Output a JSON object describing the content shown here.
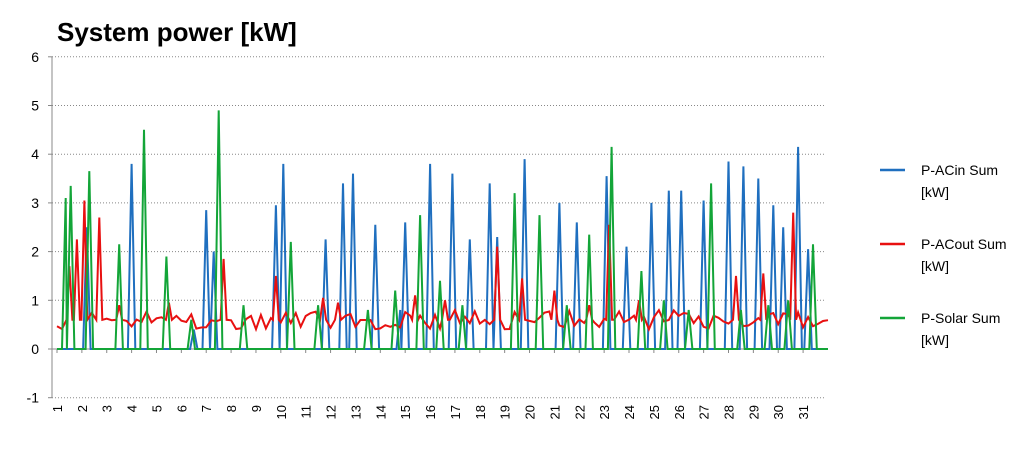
{
  "chart_data": {
    "type": "line",
    "title": "System power [kW]",
    "xlabel": "",
    "ylabel": "",
    "ylim": [
      -1,
      6
    ],
    "yticks": [
      "-1",
      "0",
      "1",
      "2",
      "3",
      "4",
      "5",
      "6"
    ],
    "xticks": [
      "1",
      "2",
      "3",
      "4",
      "5",
      "6",
      "7",
      "8",
      "9",
      "10",
      "11",
      "12",
      "13",
      "14",
      "15",
      "16",
      "17",
      "18",
      "19",
      "20",
      "21",
      "22",
      "23",
      "24",
      "25",
      "26",
      "27",
      "28",
      "29",
      "30",
      "31"
    ],
    "grid": true,
    "legend": "right",
    "series": [
      {
        "name": "P-ACin Sum [kW]",
        "legend_lines": [
          "P-ACin Sum",
          "[kW]"
        ],
        "color": "#1f6fbf",
        "baseline": 0,
        "peaks": [
          [
            2.2,
            2.5
          ],
          [
            4.0,
            3.8
          ],
          [
            6.5,
            0.4
          ],
          [
            7.0,
            2.85
          ],
          [
            7.3,
            2.0
          ],
          [
            9.8,
            2.95
          ],
          [
            10.1,
            3.8
          ],
          [
            11.8,
            2.25
          ],
          [
            12.5,
            3.4
          ],
          [
            12.9,
            3.6
          ],
          [
            13.8,
            2.55
          ],
          [
            14.8,
            0.8
          ],
          [
            15.0,
            2.6
          ],
          [
            16.0,
            3.8
          ],
          [
            16.9,
            3.6
          ],
          [
            17.6,
            2.25
          ],
          [
            18.4,
            3.4
          ],
          [
            18.7,
            2.3
          ],
          [
            19.8,
            3.9
          ],
          [
            21.2,
            3.0
          ],
          [
            21.9,
            2.6
          ],
          [
            23.1,
            3.55
          ],
          [
            23.9,
            2.1
          ],
          [
            24.9,
            3.0
          ],
          [
            25.6,
            3.25
          ],
          [
            26.1,
            3.25
          ],
          [
            27.0,
            3.05
          ],
          [
            28.0,
            3.85
          ],
          [
            28.6,
            3.75
          ],
          [
            29.2,
            3.5
          ],
          [
            29.8,
            2.95
          ],
          [
            30.2,
            2.5
          ],
          [
            30.8,
            4.15
          ],
          [
            31.2,
            2.05
          ]
        ]
      },
      {
        "name": "P-ACout Sum [kW]",
        "legend_lines": [
          "P-ACout Sum",
          "[kW]"
        ],
        "color": "#e81010",
        "baseline": 0.6,
        "peaks": [
          [
            1.5,
            1.7
          ],
          [
            1.8,
            2.25
          ],
          [
            2.1,
            3.05
          ],
          [
            2.7,
            2.7
          ],
          [
            3.5,
            0.9
          ],
          [
            5.5,
            0.95
          ],
          [
            7.7,
            1.85
          ],
          [
            9.8,
            1.5
          ],
          [
            11.7,
            1.05
          ],
          [
            12.3,
            0.95
          ],
          [
            15.4,
            1.1
          ],
          [
            16.6,
            1.0
          ],
          [
            18.7,
            2.1
          ],
          [
            19.7,
            1.45
          ],
          [
            21.0,
            1.2
          ],
          [
            22.4,
            0.9
          ],
          [
            23.2,
            2.55
          ],
          [
            24.4,
            1.0
          ],
          [
            28.3,
            1.5
          ],
          [
            29.4,
            1.55
          ],
          [
            30.6,
            2.8
          ]
        ]
      },
      {
        "name": "P-Solar Sum [kW]",
        "legend_lines": [
          "P-Solar Sum",
          "[kW]"
        ],
        "color": "#13a538",
        "baseline": 0,
        "peaks": [
          [
            1.35,
            3.1
          ],
          [
            1.55,
            3.35
          ],
          [
            2.3,
            3.65
          ],
          [
            3.5,
            2.15
          ],
          [
            4.5,
            4.5
          ],
          [
            5.4,
            1.9
          ],
          [
            6.4,
            0.6
          ],
          [
            7.5,
            4.9
          ],
          [
            8.5,
            0.9
          ],
          [
            10.4,
            2.2
          ],
          [
            11.5,
            0.9
          ],
          [
            13.5,
            0.8
          ],
          [
            14.6,
            1.2
          ],
          [
            15.6,
            2.75
          ],
          [
            16.4,
            1.4
          ],
          [
            17.3,
            0.9
          ],
          [
            19.4,
            3.2
          ],
          [
            20.4,
            2.75
          ],
          [
            21.5,
            0.9
          ],
          [
            22.4,
            2.35
          ],
          [
            23.3,
            4.15
          ],
          [
            24.5,
            1.6
          ],
          [
            25.4,
            1.0
          ],
          [
            26.4,
            0.8
          ],
          [
            27.3,
            3.4
          ],
          [
            28.5,
            0.8
          ],
          [
            29.6,
            0.9
          ],
          [
            30.4,
            1.0
          ],
          [
            31.4,
            2.15
          ]
        ]
      }
    ]
  }
}
